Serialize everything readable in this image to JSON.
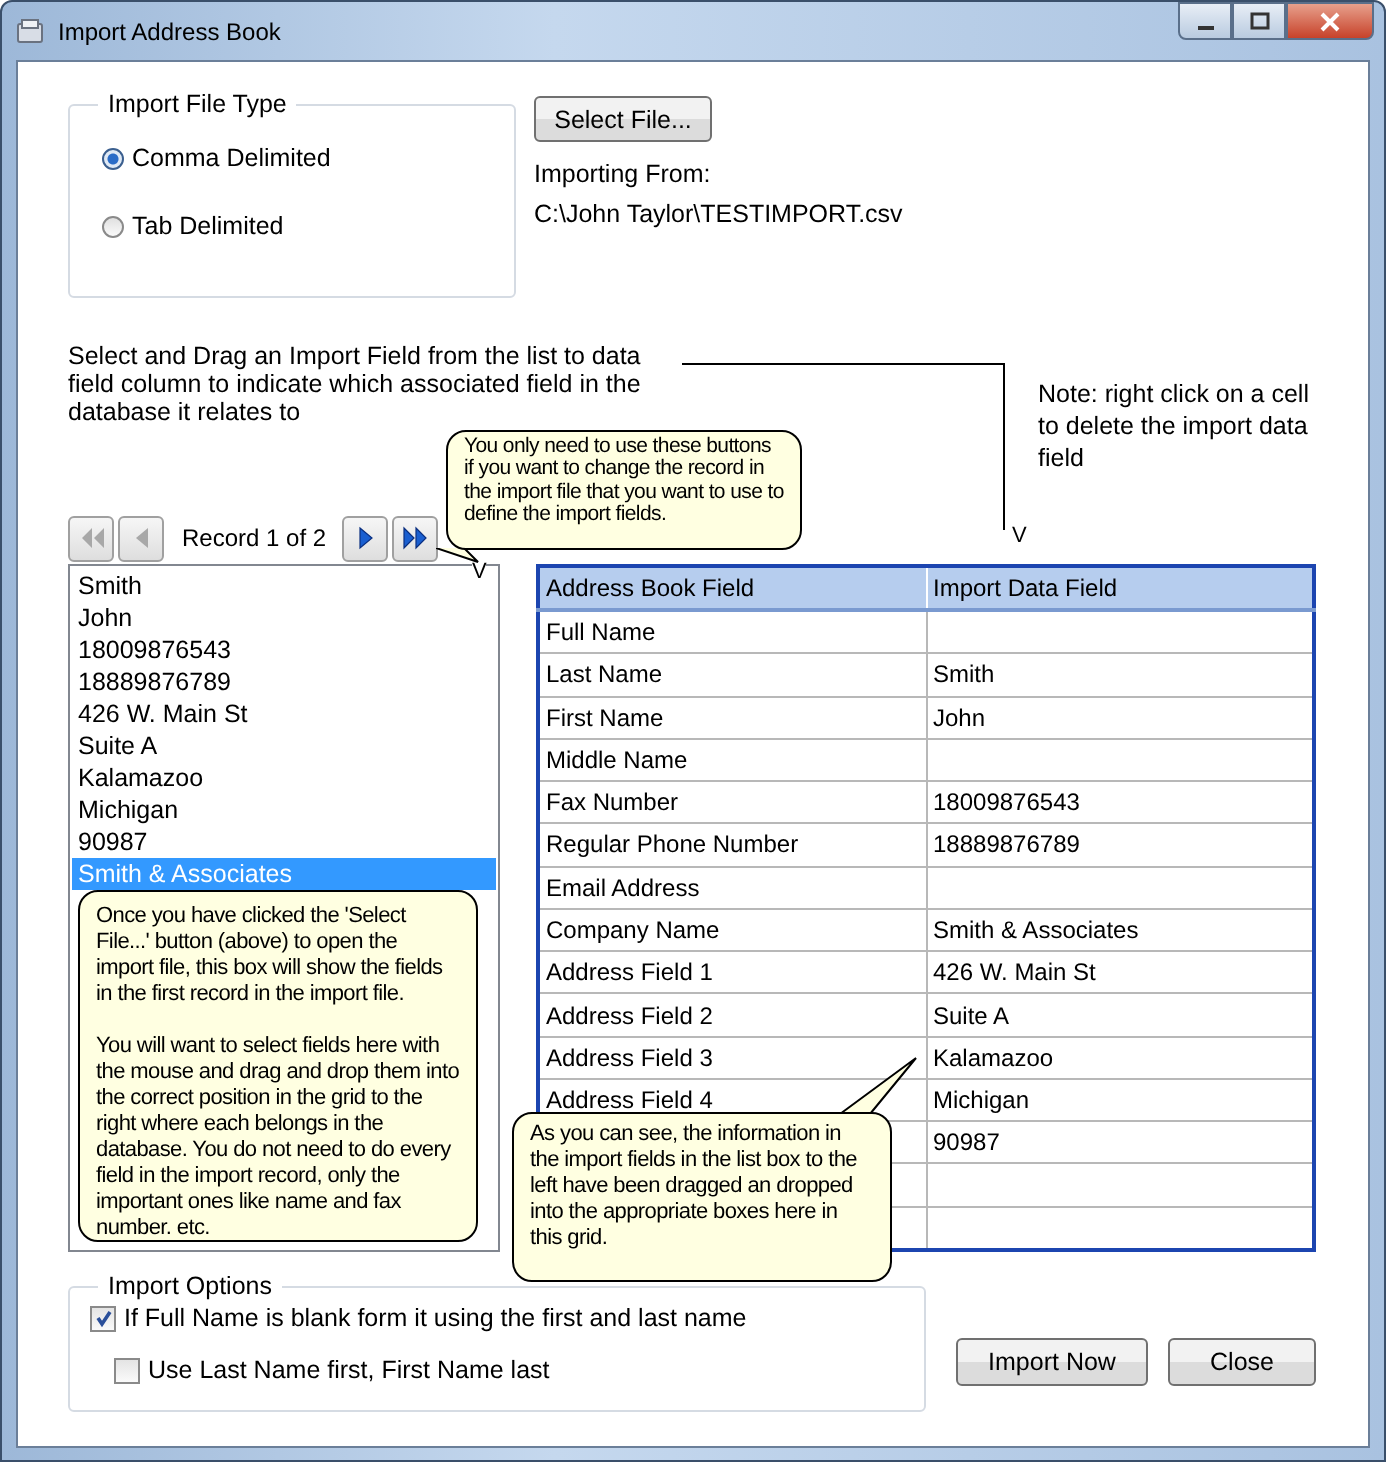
{
  "window": {
    "title": "Import Address Book"
  },
  "file_type": {
    "title": "Import File Type",
    "options": [
      {
        "label": "Comma Delimited",
        "selected": true
      },
      {
        "label": "Tab Delimited",
        "selected": false
      }
    ]
  },
  "select_button": "Select File...",
  "importing_from_label": "Importing From:",
  "importing_from_path": "C:\\John Taylor\\TESTIMPORT.csv",
  "instructions": "Select and Drag an Import Field from the list to data field column to indicate which associated field in the database it relates to",
  "note": "Note: right click on a cell to delete the import data field",
  "markers": [
    "V",
    "V"
  ],
  "nav": {
    "record": "Record 1 of 2",
    "buttons": [
      {
        "kind": "first",
        "disabled": true
      },
      {
        "kind": "prev",
        "disabled": true
      },
      {
        "kind": "next",
        "disabled": false
      },
      {
        "kind": "last",
        "disabled": false
      }
    ]
  },
  "import_list": [
    {
      "label": "Smith",
      "selected": false
    },
    {
      "label": "John",
      "selected": false
    },
    {
      "label": "18009876543",
      "selected": false
    },
    {
      "label": "18889876789",
      "selected": false
    },
    {
      "label": "426 W. Main St",
      "selected": false
    },
    {
      "label": "Suite A",
      "selected": false
    },
    {
      "label": "Kalamazoo",
      "selected": false
    },
    {
      "label": "Michigan",
      "selected": false
    },
    {
      "label": "90987",
      "selected": false
    },
    {
      "label": "Smith & Associates",
      "selected": true
    }
  ],
  "grid": {
    "columns": [
      "Address Book Field",
      "Import Data Field"
    ],
    "rows": [
      {
        "field": "Full Name"
      },
      {
        "field": "Last Name",
        "value": "Smith"
      },
      {
        "field": "First Name",
        "value": "John"
      },
      {
        "field": "Middle Name"
      },
      {
        "field": "Fax Number",
        "value": "18009876543"
      },
      {
        "field": "Regular Phone Number",
        "value": "18889876789"
      },
      {
        "field": "Email Address"
      },
      {
        "field": "Company Name",
        "value": "Smith & Associates"
      },
      {
        "field": "Address Field 1",
        "value": "426 W. Main St"
      },
      {
        "field": "Address Field 2",
        "value": "Suite A"
      },
      {
        "field": "Address Field 3",
        "value": "Kalamazoo"
      },
      {
        "field": "Address Field 4",
        "value": "Michigan"
      },
      {
        "value": "90987"
      },
      {},
      {}
    ]
  },
  "callouts": [
    {
      "paragraphs": [
        "You only need to use these buttons if you want to change the record in the import file that you want to use to define the import fields."
      ]
    },
    {
      "paragraphs": [
        "Once you have clicked the 'Select File...' button (above) to open the import file, this box will show the fields in the first record in the import file.",
        "You will want to select fields here with the mouse and drag and drop them into the correct position in the grid to the right where each belongs in the database.  You do not need to do every field in the import record, only the important ones like name and fax number. etc."
      ]
    },
    {
      "paragraphs": [
        "As you can see, the information in the import fields in the list box to the left have been dragged an dropped into the appropriate boxes here in this grid."
      ]
    }
  ],
  "options": {
    "title": "Import Options",
    "items": [
      {
        "label": "If Full Name is blank form it using the first and last name",
        "checked": true
      },
      {
        "label": "Use Last Name first, First Name last",
        "checked": false
      }
    ]
  },
  "buttons": [
    "Import Now",
    "Close"
  ]
}
